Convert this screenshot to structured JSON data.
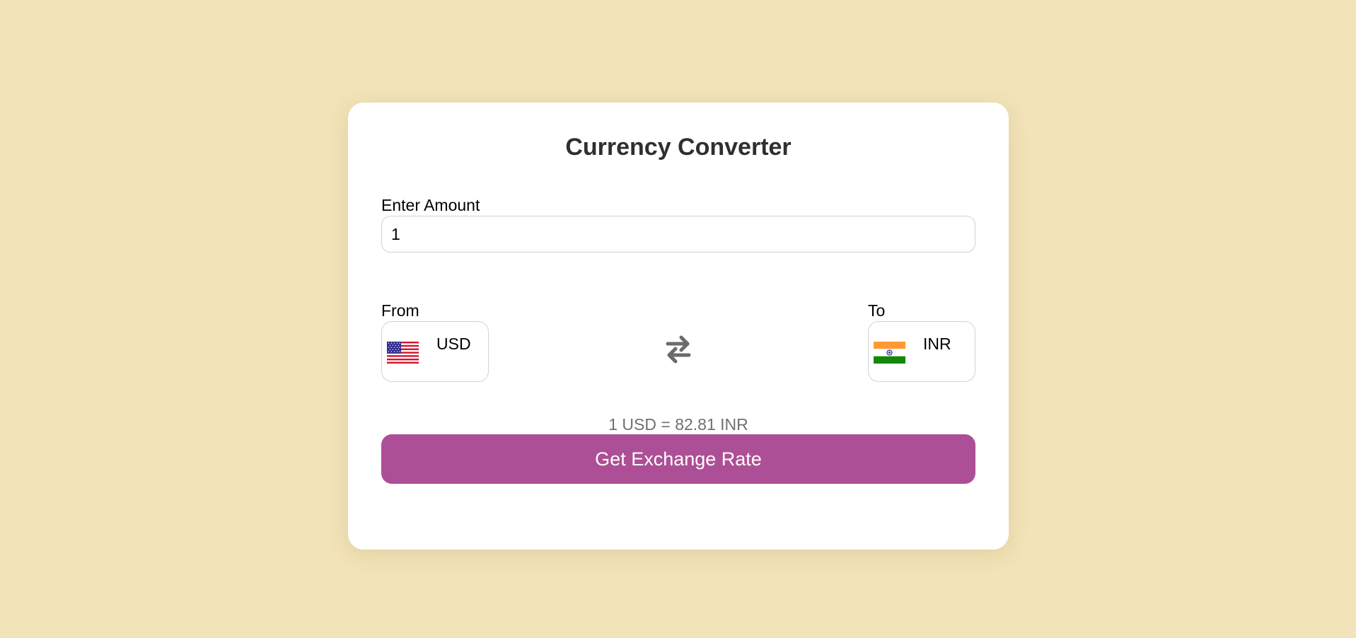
{
  "app": {
    "title": "Currency Converter"
  },
  "amount": {
    "label": "Enter Amount",
    "value": "1"
  },
  "from": {
    "label": "From",
    "currency": "USD",
    "flag_icon": "us-flag-icon"
  },
  "to": {
    "label": "To",
    "currency": "INR",
    "flag_icon": "india-flag-icon"
  },
  "swap_icon": "swap-arrows-icon",
  "result": {
    "text": "1 USD = 82.81 INR"
  },
  "button": {
    "label": "Get Exchange Rate"
  },
  "colors": {
    "background": "#f2e3b8",
    "card": "#ffffff",
    "button": "#ad4f96",
    "rate_text": "#707070"
  }
}
